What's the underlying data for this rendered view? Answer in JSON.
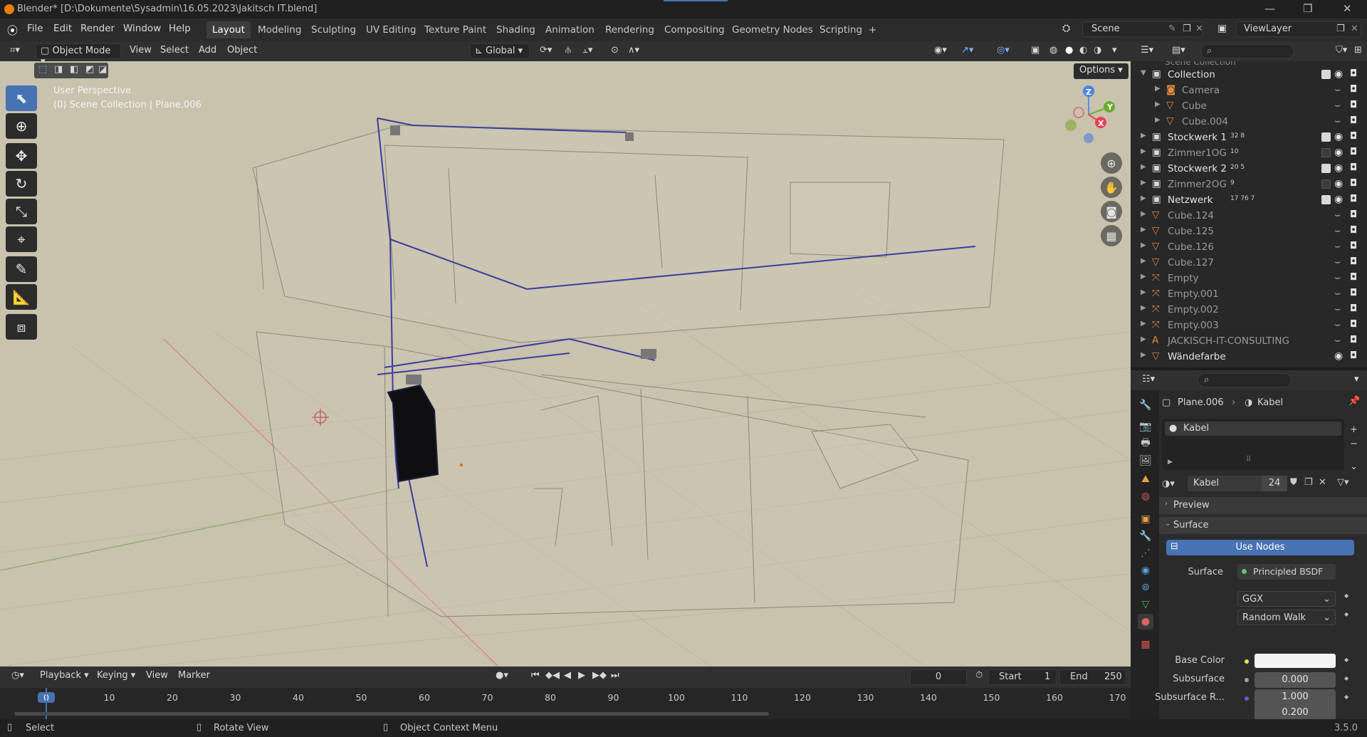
{
  "title_bar": {
    "title": "Blender* [D:\\Dokumente\\Sysadmin\\16.05.2023\\Jakitsch IT.blend]",
    "minimize": "—",
    "maximize": "❐",
    "close": "✕"
  },
  "menu": {
    "items": [
      "File",
      "Edit",
      "Render",
      "Window",
      "Help"
    ]
  },
  "workspaces": {
    "tabs": [
      "Layout",
      "Modeling",
      "Sculpting",
      "UV Editing",
      "Texture Paint",
      "Shading",
      "Animation",
      "Rendering",
      "Compositing",
      "Geometry Nodes",
      "Scripting"
    ],
    "active": "Layout",
    "add": "+"
  },
  "scene": {
    "label": "Scene",
    "view_layer": "ViewLayer"
  },
  "viewport_header": {
    "mode": "Object Mode",
    "menus": [
      "View",
      "Select",
      "Add",
      "Object"
    ],
    "transform": "Global"
  },
  "viewport": {
    "perspective": "User Perspective",
    "context": "(0) Scene Collection | Plane.006",
    "options": "Options"
  },
  "gizmo": {
    "x": "X",
    "y": "Y",
    "z": "Z"
  },
  "outliner": {
    "header_partial": "Scene Collection",
    "rows": [
      {
        "name": "Collection",
        "type": "collection",
        "depth": 0,
        "checked": true,
        "visible": true,
        "badge": ""
      },
      {
        "name": "Camera",
        "type": "camera",
        "depth": 1,
        "checked": null,
        "visible": false,
        "badge": ""
      },
      {
        "name": "Cube",
        "type": "mesh",
        "depth": 1,
        "checked": null,
        "visible": false,
        "badge": ""
      },
      {
        "name": "Cube.004",
        "type": "mesh",
        "depth": 1,
        "checked": null,
        "visible": false,
        "badge": ""
      },
      {
        "name": "Stockwerk 1",
        "type": "collection",
        "depth": 0,
        "checked": true,
        "visible": true,
        "badge": "32 8"
      },
      {
        "name": "Zimmer1OG",
        "type": "collection",
        "depth": 0,
        "checked": false,
        "visible": true,
        "badge": "10"
      },
      {
        "name": "Stockwerk 2",
        "type": "collection",
        "depth": 0,
        "checked": true,
        "visible": true,
        "badge": "20 5"
      },
      {
        "name": "Zimmer2OG",
        "type": "collection",
        "depth": 0,
        "checked": false,
        "visible": true,
        "badge": "9"
      },
      {
        "name": "Netzwerk",
        "type": "collection",
        "depth": 0,
        "checked": true,
        "visible": true,
        "badge": "17 76 7"
      },
      {
        "name": "Cube.124",
        "type": "mesh",
        "depth": 0,
        "checked": null,
        "visible": false,
        "badge": ""
      },
      {
        "name": "Cube.125",
        "type": "mesh",
        "depth": 0,
        "checked": null,
        "visible": false,
        "badge": ""
      },
      {
        "name": "Cube.126",
        "type": "mesh",
        "depth": 0,
        "checked": null,
        "visible": false,
        "badge": ""
      },
      {
        "name": "Cube.127",
        "type": "mesh",
        "depth": 0,
        "checked": null,
        "visible": false,
        "badge": ""
      },
      {
        "name": "Empty",
        "type": "empty",
        "depth": 0,
        "checked": null,
        "visible": false,
        "badge": ""
      },
      {
        "name": "Empty.001",
        "type": "empty",
        "depth": 0,
        "checked": null,
        "visible": false,
        "badge": ""
      },
      {
        "name": "Empty.002",
        "type": "empty",
        "depth": 0,
        "checked": null,
        "visible": false,
        "badge": ""
      },
      {
        "name": "Empty.003",
        "type": "empty",
        "depth": 0,
        "checked": null,
        "visible": false,
        "badge": ""
      },
      {
        "name": "JACKISCH-IT-CONSULTING",
        "type": "text",
        "depth": 0,
        "checked": null,
        "visible": false,
        "badge": ""
      },
      {
        "name": "Wändefarbe",
        "type": "mesh",
        "depth": 0,
        "checked": null,
        "visible": true,
        "badge": ""
      }
    ]
  },
  "properties": {
    "breadcrumb_object": "Plane.006",
    "breadcrumb_material": "Kabel",
    "slot_name": "Kabel",
    "material_name": "Kabel",
    "users": "24",
    "preview": "Preview",
    "surface_panel": "Surface",
    "use_nodes": "Use Nodes",
    "surface_label": "Surface",
    "surface_value": "Principled BSDF",
    "distribution": "GGX",
    "subsurface_method": "Random Walk",
    "base_color_label": "Base Color",
    "subsurface_label": "Subsurface",
    "subsurface_value": "0.000",
    "subsurface_radius_label": "Subsurface R...",
    "subsurface_radius_1": "1.000",
    "subsurface_radius_2": "0.200"
  },
  "timeline": {
    "menus": [
      "Playback",
      "Keying",
      "View",
      "Marker"
    ],
    "current_frame": "0",
    "start_label": "Start",
    "start": "1",
    "end_label": "End",
    "end": "250",
    "ticks": [
      "0",
      "10",
      "20",
      "30",
      "40",
      "50",
      "60",
      "70",
      "80",
      "90",
      "100",
      "110",
      "120",
      "130",
      "140",
      "150",
      "160",
      "170"
    ]
  },
  "status": {
    "left": "Select",
    "middle": "Rotate View",
    "right": "Object Context Menu",
    "version": "3.5.0"
  }
}
